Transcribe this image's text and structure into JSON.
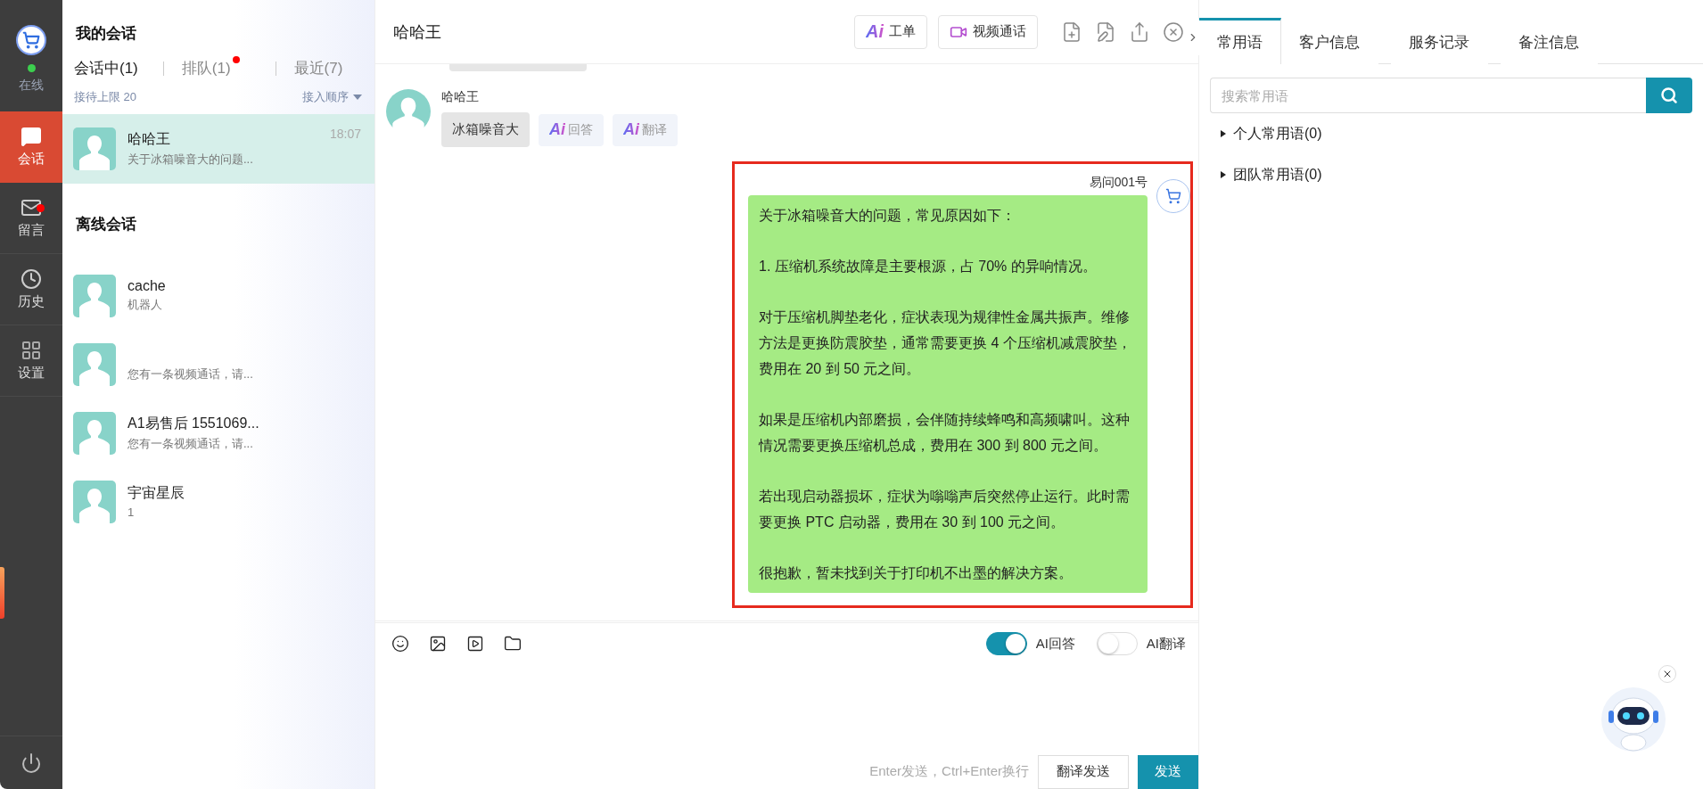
{
  "nav": {
    "status": "在线",
    "online": true,
    "items": [
      {
        "label": "会话",
        "selected": true,
        "badge": false
      },
      {
        "label": "留言",
        "selected": false,
        "badge": true
      },
      {
        "label": "历史",
        "selected": false,
        "badge": false
      },
      {
        "label": "设置",
        "selected": false,
        "badge": false
      }
    ]
  },
  "conversations": {
    "title": "我的会话",
    "tabs": [
      {
        "label": "会话中(1)",
        "selected": true,
        "badge": false
      },
      {
        "label": "排队(1)",
        "selected": false,
        "badge": true
      },
      {
        "label": "最近(7)",
        "selected": false,
        "badge": false
      }
    ],
    "limit": "接待上限 20",
    "sort": "接入顺序",
    "active": [
      {
        "name": "哈哈王",
        "preview": "关于冰箱噪音大的问题...",
        "time": "18:07",
        "selected": true
      }
    ],
    "offline_title": "离线会话",
    "offline": [
      {
        "name": "cache",
        "preview": "机器人"
      },
      {
        "preview": "您有一条视频通话，请..."
      },
      {
        "name": "A1易售后 1551069...",
        "preview": "您有一条视频通话，请..."
      },
      {
        "name": "宇宙星辰",
        "preview": "1"
      }
    ]
  },
  "chat": {
    "title": "哈哈王",
    "header_buttons": [
      {
        "kind": "ai",
        "mark": "Ai",
        "label": "工单"
      },
      {
        "kind": "video",
        "label": "视频通话"
      }
    ],
    "messages": [
      {
        "kind": "customer",
        "sender": "哈哈王",
        "text": "冰箱噪音大",
        "actions": [
          {
            "mark": "Ai",
            "label": "回答"
          },
          {
            "mark": "Ai",
            "label": "翻译"
          }
        ]
      },
      {
        "kind": "agent",
        "sender": "易问001号",
        "highlighted": true,
        "paragraphs": [
          "关于冰箱噪音大的问题，常见原因如下：",
          "1. 压缩机系统故障是主要根源，占 70% 的异响情况。",
          "对于压缩机脚垫老化，症状表现为规律性金属共振声。维修方法是更换防震胶垫，通常需要更换 4 个压缩机减震胶垫，费用在 20 到 50 元之间。",
          "如果是压缩机内部磨损，会伴随持续蜂鸣和高频啸叫。这种情况需要更换压缩机总成，费用在 300 到 800 元之间。",
          "若出现启动器损坏，症状为嗡嗡声后突然停止运行。此时需要更换 PTC 启动器，费用在 30 到 100 元之间。",
          "很抱歉，暂未找到关于打印机不出墨的解决方案。"
        ]
      }
    ],
    "toggles": [
      {
        "label": "AI回答",
        "on": true
      },
      {
        "label": "AI翻译",
        "on": false
      }
    ],
    "hint": "Enter发送，Ctrl+Enter换行",
    "buttons": [
      {
        "label": "翻译发送",
        "primary": false
      },
      {
        "label": "发送",
        "primary": true
      }
    ]
  },
  "side": {
    "tabs": [
      {
        "label": "常用语",
        "selected": true
      },
      {
        "label": "客户信息",
        "selected": false
      },
      {
        "label": "服务记录",
        "selected": false
      },
      {
        "label": "备注信息",
        "selected": false
      }
    ],
    "search": {
      "placeholder": "搜索常用语"
    },
    "groups": [
      {
        "label": "个人常用语(0)",
        "expanded": false
      },
      {
        "label": "团队常用语(0)",
        "expanded": false
      }
    ]
  }
}
